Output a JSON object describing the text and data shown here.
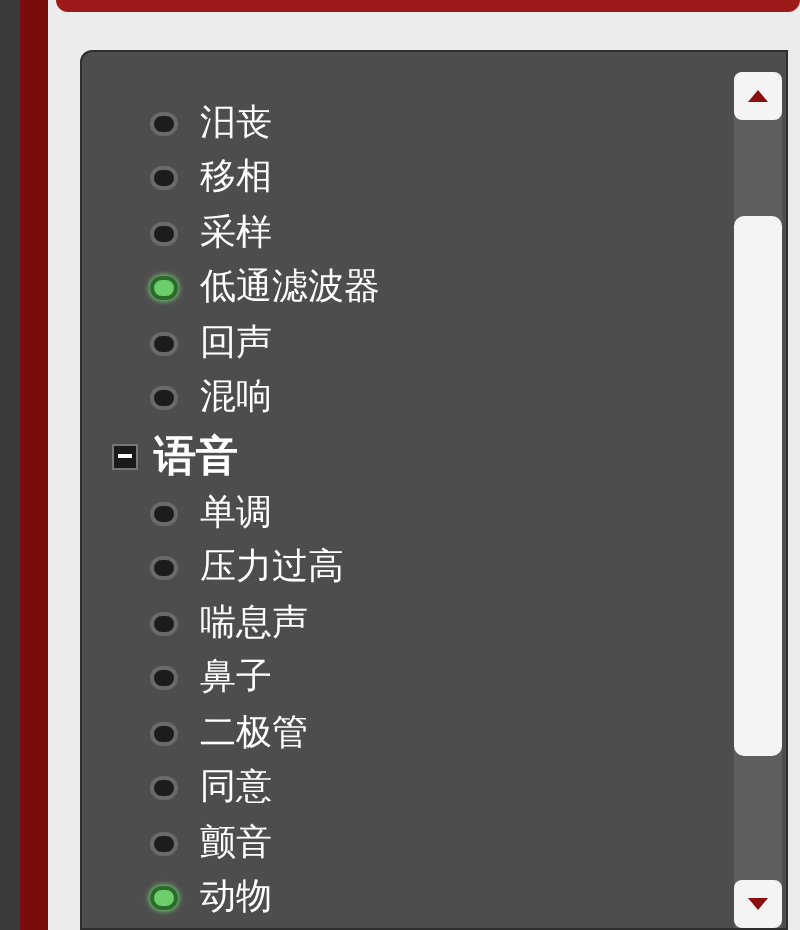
{
  "effects": [
    {
      "label": "汨丧",
      "selected": false
    },
    {
      "label": "移相",
      "selected": false
    },
    {
      "label": "采样",
      "selected": false
    },
    {
      "label": "低通滤波器",
      "selected": true
    },
    {
      "label": "回声",
      "selected": false
    },
    {
      "label": "混响",
      "selected": false
    }
  ],
  "groups": [
    {
      "label": "语音",
      "expanded": true,
      "children": [
        {
          "label": "单调",
          "selected": false
        },
        {
          "label": "压力过高",
          "selected": false
        },
        {
          "label": "喘息声",
          "selected": false
        },
        {
          "label": "鼻子",
          "selected": false
        },
        {
          "label": "二极管",
          "selected": false
        },
        {
          "label": "同意",
          "selected": false
        },
        {
          "label": "颤音",
          "selected": false
        },
        {
          "label": "动物",
          "selected": true
        }
      ]
    }
  ]
}
